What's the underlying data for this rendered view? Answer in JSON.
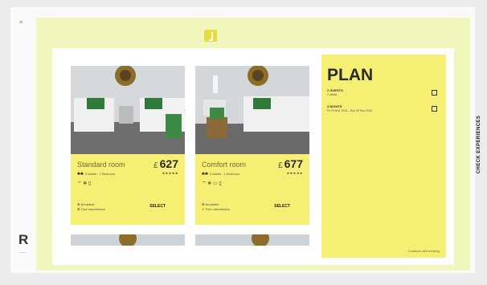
{
  "brand": {
    "mark": "R",
    "tiny": "≡",
    "sub": "——"
  },
  "plan": {
    "title": "PLAN",
    "guests_label": "2 GUESTS",
    "guests_value": "2 adults",
    "dates_label": "3 NIGHTS",
    "dates_value": "Fri 23 Nov 2018 – Sun 25 Nov 2018",
    "footer": "Continue with booking"
  },
  "side_label": "CHECK EXPERIENCES",
  "rooms": [
    {
      "name": "Standard room",
      "currency": "£",
      "price": "627",
      "stars": "★★★★★",
      "people": "♣♣",
      "amenities": "2 Adults · 1 Bedroom",
      "features": "⌔ ❄ ▯",
      "policy1": "Breakfast",
      "policy2": "Free cancellation",
      "select": "SELECT"
    },
    {
      "name": "Comfort room",
      "currency": "£",
      "price": "677",
      "stars": "★★★★★",
      "people": "♣♣",
      "amenities": "2 Adults · 1 Bedroom",
      "features": "⌔ ❄ ▭ ▯",
      "policy1": "Breakfast",
      "policy2": "Free cancellation",
      "select": "SELECT"
    }
  ],
  "colors": {
    "accent": "#f5ef74",
    "panel": "#f1f6bd",
    "logo": "#e7dc3e"
  }
}
